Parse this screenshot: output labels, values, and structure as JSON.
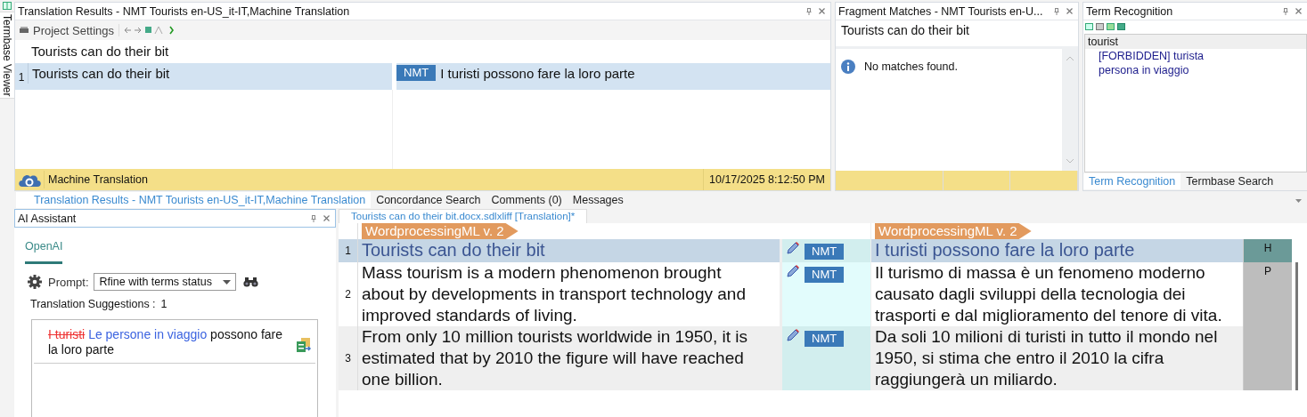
{
  "side_tab": {
    "label": "Termbase Viewer"
  },
  "translation_results": {
    "title": "Translation Results - NMT Tourists en-US_it-IT,Machine Translation",
    "toolbar_label": "Project Settings",
    "source": "Tourists can do their bit",
    "rows": [
      {
        "number": "1",
        "source": "Tourists can do their bit",
        "origin": "NMT",
        "target": "I turisti possono fare la loro parte",
        "selected": true
      }
    ],
    "status": {
      "provider": "Machine Translation",
      "timestamp": "10/17/2025 8:12:50 PM"
    }
  },
  "bottom_tabs": [
    {
      "label": "Translation Results - NMT Tourists en-US_it-IT,Machine Translation",
      "selected": true
    },
    {
      "label": "Concordance Search",
      "selected": false
    },
    {
      "label": "Comments (0)",
      "selected": false
    },
    {
      "label": "Messages",
      "selected": false
    }
  ],
  "fragment_matches": {
    "title": "Fragment Matches - NMT Tourists en-U...",
    "source": "Tourists can do their bit",
    "message": "No matches found."
  },
  "term_recognition": {
    "title": "Term Recognition",
    "terms": [
      {
        "text": "tourist",
        "children": [
          {
            "text": "[FORBIDDEN] turista"
          },
          {
            "text": "persona in viaggio"
          }
        ]
      }
    ],
    "tabs": [
      {
        "label": "Term Recognition",
        "selected": true
      },
      {
        "label": "Termbase Search",
        "selected": false
      }
    ]
  },
  "ai_assistant": {
    "title": "AI Assistant",
    "tabs": [
      {
        "label": "OpenAI",
        "selected": true
      }
    ],
    "prompt_label": "Prompt:",
    "prompt_value": "Rfine with terms status",
    "suggestions_label": "Translation Suggestions :",
    "suggestions_count": "1",
    "suggestions": [
      {
        "deleted": "I turisti",
        "inserted": "Le persone in viaggio",
        "rest": "possono fare la loro parte"
      }
    ]
  },
  "editor": {
    "tabs": [
      {
        "label": "Tourists can do their bit.docx.sdlxliff [Translation]*",
        "selected": true
      }
    ],
    "source_tag": "WordprocessingML v. 2",
    "target_tag": "WordprocessingML v. 2",
    "segments": [
      {
        "number": "1",
        "source": "Tourists can do their bit",
        "origin": "NMT",
        "target": "I turisti possono fare la loro parte",
        "status": "H",
        "selected": true
      },
      {
        "number": "2",
        "source": "Mass tourism is a modern phenomenon brought about by developments in transport technology and improved standards of living.",
        "origin": "NMT",
        "target": "Il turismo di massa è un fenomeno moderno causato dagli sviluppi della tecnologia dei trasporti e dal miglioramento del tenore di vita.",
        "status": "P",
        "selected": false
      },
      {
        "number": "3",
        "source": "From only 10 million tourists worldwide in 1950, it is estimated that by 2010 the figure will have reached one billion.",
        "origin": "NMT",
        "target": "Da soli 10 milioni di turisti in tutto il mondo nel 1950, si stima che entro il 2010 la cifra raggiungerà un miliardo.",
        "selected": false
      }
    ]
  }
}
